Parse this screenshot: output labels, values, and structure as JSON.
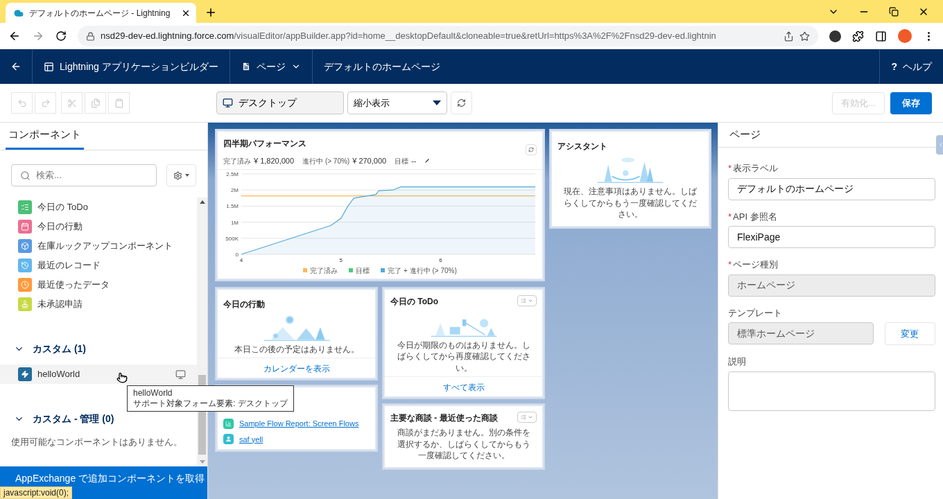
{
  "browser": {
    "tab_title": "デフォルトのホームページ - Lightning",
    "url_host": "nsd29-dev-ed.lightning.force.com",
    "url_path": "/visualEditor/appBuilder.app?id=home__desktopDefault&cloneable=true&retUrl=https%3A%2F%2Fnsd29-dev-ed.lightnin",
    "status_text": "javascript:void(0);"
  },
  "app_nav": {
    "title": "Lightning アプリケーションビルダー",
    "page_menu": "ページ",
    "page_name": "デフォルトのホームページ",
    "help_mark": "?",
    "help": "ヘルプ"
  },
  "toolbar": {
    "edit_buttons": [
      {
        "kind": "undo",
        "disabled": true
      },
      {
        "kind": "redo",
        "disabled": true
      },
      {
        "kind": "cut",
        "disabled": true
      },
      {
        "kind": "copy",
        "disabled": true
      },
      {
        "kind": "paste",
        "disabled": true
      }
    ],
    "device": "デスクトップ",
    "zoom": "縮小表示",
    "activate": {
      "label": "有効化...",
      "disabled": true
    },
    "save": "保存"
  },
  "left_panel": {
    "tab": {
      "label": "コンポーネント",
      "selected": true
    },
    "search_placeholder": "検索...",
    "standard_items": [
      {
        "label": "今日の ToDo",
        "kind": "todo",
        "color": "#4bc076"
      },
      {
        "label": "今日の行動",
        "kind": "event",
        "color": "#eb7092"
      },
      {
        "label": "在庫ルックアップコンポーネント",
        "kind": "box",
        "color": "#5a9ae0"
      },
      {
        "label": "最近のレコード",
        "kind": "history",
        "color": "#62b7ed"
      },
      {
        "label": "最近使ったデータ",
        "kind": "clock",
        "color": "#ff9a3c"
      },
      {
        "label": "未承認申請",
        "kind": "stamp",
        "color": "#c8d945"
      }
    ],
    "sections": [
      {
        "title": "カスタム (1)",
        "expanded": true,
        "items": [
          {
            "label": "helloWorld",
            "hovered": true
          }
        ]
      },
      {
        "title": "カスタム - 管理 (0)",
        "expanded": true,
        "empty_text": "使用可能なコンポーネントはありません。"
      }
    ],
    "appexchange_button": "AppExchange で追加コンポーネントを取得"
  },
  "tooltip": {
    "title": "helloWorld",
    "text": "サポート対象フォーム要素: デスクトップ"
  },
  "canvas": {
    "performance": {
      "title": "四半期パフォーマンス",
      "stats": [
        {
          "label": "完了済み",
          "value": "¥ 1,820,000"
        },
        {
          "label": "進行中 (> 70%)",
          "value": "¥ 270,000"
        },
        {
          "label": "目標",
          "value": "--"
        }
      ],
      "chart_data": {
        "type": "line",
        "grid": true,
        "legend": true,
        "x": [
          4,
          4.9,
          5,
          5.07,
          5.13,
          5.35,
          5.38,
          5.52,
          5.6,
          6.95
        ],
        "xlim": [
          4,
          6.95
        ],
        "ylim": [
          0,
          2500000
        ],
        "xticks": [
          4,
          5,
          6
        ],
        "yticks": [
          {
            "value": 0,
            "label": "0"
          },
          {
            "value": 500000,
            "label": "500K"
          },
          {
            "value": 1000000,
            "label": "1M"
          },
          {
            "value": 1500000,
            "label": "1.5M"
          },
          {
            "value": 2000000,
            "label": "2M"
          },
          {
            "value": 2500000,
            "label": "2.5M"
          }
        ],
        "series": [
          {
            "name": "完了済み",
            "color": "#ffb75d",
            "values": [
              1820000,
              1820000,
              1820000,
              1820000,
              1820000,
              1820000,
              1820000,
              1820000,
              1820000,
              1820000
            ]
          },
          {
            "name": "目標",
            "color": "#4bca81",
            "values": [
              null,
              null,
              null,
              null,
              null,
              null,
              null,
              null,
              null,
              null
            ]
          },
          {
            "name": "完了 + 進行中 (> 70%)",
            "color": "#54a9d9",
            "values": [
              0,
              900000,
              1120000,
              1500000,
              1750000,
              1860000,
              1980000,
              2000000,
              2100000,
              2100000
            ]
          }
        ]
      }
    },
    "assistant": {
      "title": "アシスタント",
      "message": "現在、注意事項はありません。しばらくしてからもう一度確認してください。"
    },
    "events": {
      "title": "今日の行動",
      "message": "本日この後の予定はありません。",
      "link": "カレンダーを表示"
    },
    "todo": {
      "title": "今日の ToDo",
      "message": "今日が期限のものはありません。しばらくしてから再度確認してください。",
      "link": "すべて表示"
    },
    "flows": {
      "items": [
        {
          "label": "Sample Flow Report: Screen Flows",
          "kind": "report"
        },
        {
          "label": "saf yell",
          "kind": "user"
        }
      ]
    },
    "opportunities": {
      "title": "主要な商談 - 最近使った商談",
      "message": "商談がまだありません。別の条件を選択するか、しばらくしてからもう一度確認してください。"
    }
  },
  "right_panel": {
    "header": "ページ",
    "required_mark": "*",
    "fields": [
      {
        "label": "表示ラベル",
        "required": true,
        "kind": "text",
        "value": "デフォルトのホームページ"
      },
      {
        "label": "API 参照名",
        "required": true,
        "kind": "text",
        "value": "FlexiPage"
      },
      {
        "label": "ページ種別",
        "required": true,
        "kind": "readonly",
        "value": "ホームページ"
      },
      {
        "label": "テンプレート",
        "required": false,
        "kind": "readonly",
        "value": "標準ホームページ",
        "button": "変更"
      },
      {
        "label": "説明",
        "required": false,
        "kind": "textarea"
      }
    ]
  }
}
